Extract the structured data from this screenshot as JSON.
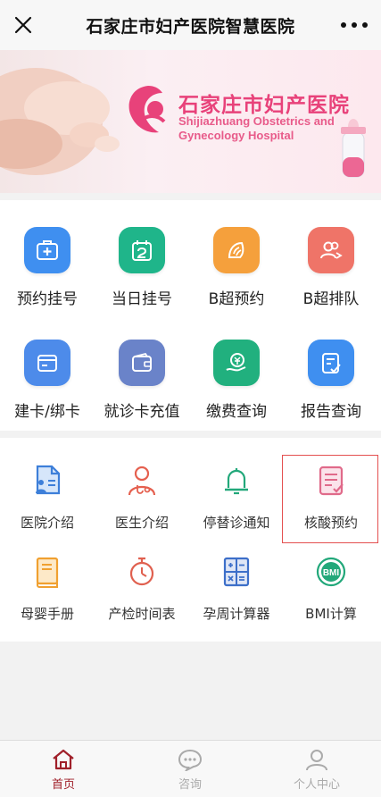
{
  "header": {
    "title": "石家庄市妇产医院智慧医院",
    "close_icon": "close-icon",
    "more_icon": "more-icon"
  },
  "banner": {
    "cn_name": "石家庄市妇产医院",
    "en_name": "Shijiazhuang Obstetrics and Gynecology Hospital",
    "logo_color": "#e8427a"
  },
  "services": [
    {
      "label": "预约挂号",
      "icon": "hospital-kit-icon",
      "color": "#3f8ff0"
    },
    {
      "label": "当日挂号",
      "icon": "calendar-icon",
      "color": "#1fb58a"
    },
    {
      "label": "B超预约",
      "icon": "ultrasound-icon",
      "color": "#f5a03c"
    },
    {
      "label": "B超排队",
      "icon": "queue-icon",
      "color": "#ef7468"
    },
    {
      "label": "建卡/绑卡",
      "icon": "card-icon",
      "color": "#4d8bea"
    },
    {
      "label": "就诊卡充值",
      "icon": "wallet-icon",
      "color": "#6a83c9"
    },
    {
      "label": "缴费查询",
      "icon": "payment-icon",
      "color": "#21b07e"
    },
    {
      "label": "报告查询",
      "icon": "report-icon",
      "color": "#3f8ff0"
    }
  ],
  "info_links": [
    {
      "label": "医院介绍",
      "icon": "hospital-info-icon",
      "color": "#3d7fd9"
    },
    {
      "label": "医生介绍",
      "icon": "doctor-icon",
      "color": "#e5604f"
    },
    {
      "label": "停替诊通知",
      "icon": "bell-icon",
      "color": "#22a87a"
    },
    {
      "label": "核酸预约",
      "icon": "checklist-icon",
      "color": "#e06a8a"
    },
    {
      "label": "母婴手册",
      "icon": "book-icon",
      "color": "#f0a030"
    },
    {
      "label": "产检时间表",
      "icon": "stopwatch-icon",
      "color": "#e0604f"
    },
    {
      "label": "孕周计算器",
      "icon": "calculator-icon",
      "color": "#3d6fc9"
    },
    {
      "label": "BMI计算",
      "icon": "bmi-icon",
      "color": "#22a87a"
    }
  ],
  "tabs": [
    {
      "label": "首页",
      "icon": "home-icon",
      "active": true
    },
    {
      "label": "咨询",
      "icon": "chat-icon",
      "active": false
    },
    {
      "label": "个人中心",
      "icon": "person-icon",
      "active": false
    }
  ],
  "colors": {
    "active_tab": "#a0202a",
    "inactive_tab": "#aaaaaa",
    "highlight_border": "#e45050"
  }
}
